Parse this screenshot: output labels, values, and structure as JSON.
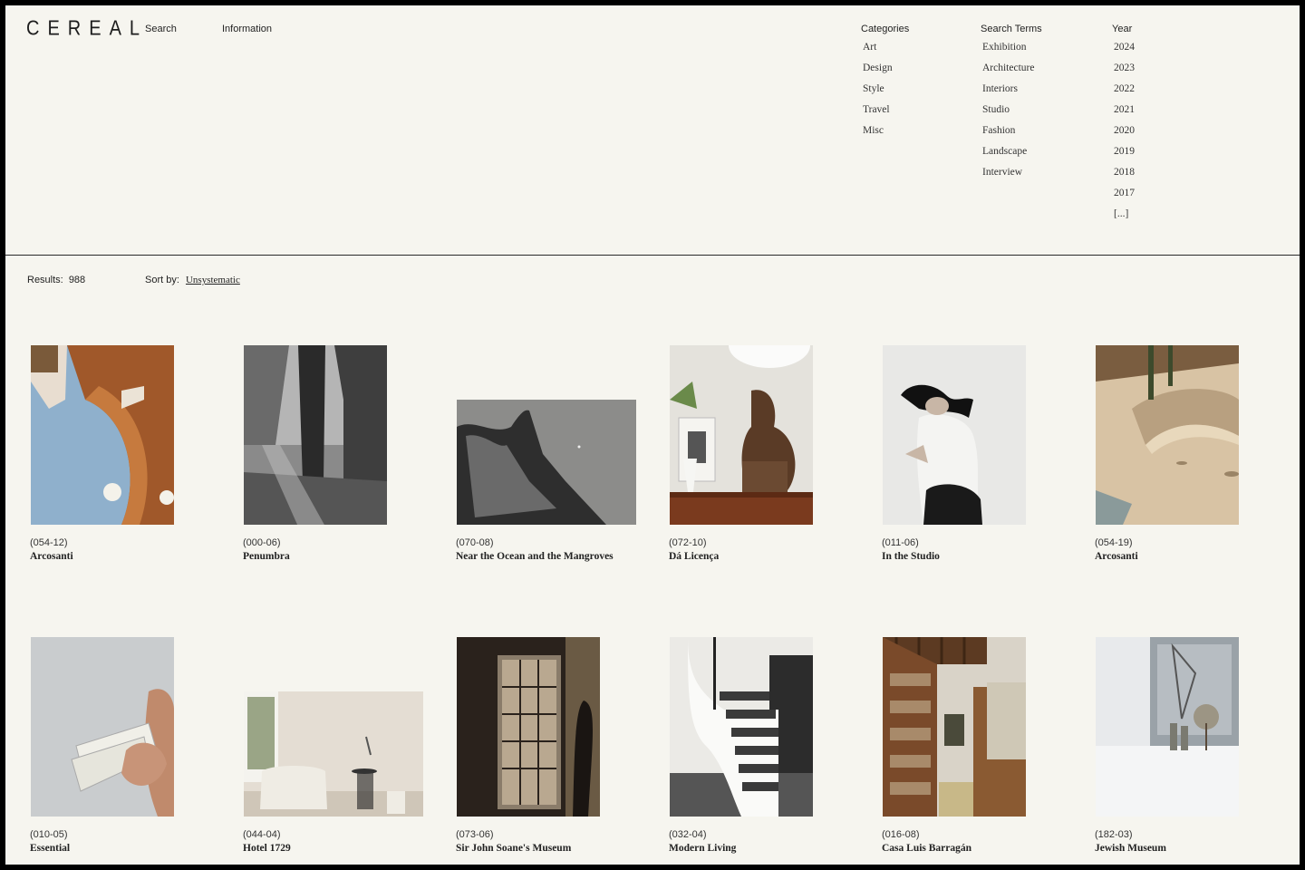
{
  "header": {
    "logo": "CEREAL",
    "nav": {
      "search": "Search",
      "information": "Information"
    }
  },
  "filters": {
    "categories": {
      "heading": "Categories",
      "items": [
        "Art",
        "Design",
        "Style",
        "Travel",
        "Misc"
      ]
    },
    "search_terms": {
      "heading": "Search Terms",
      "items": [
        "Exhibition",
        "Architecture",
        "Interiors",
        "Studio",
        "Fashion",
        "Landscape",
        "Interview"
      ]
    },
    "year": {
      "heading": "Year",
      "items": [
        "2024",
        "2023",
        "2022",
        "2021",
        "2020",
        "2019",
        "2018",
        "2017",
        "[...]"
      ]
    }
  },
  "toolbar": {
    "results_label": "Results:",
    "results_count": "988",
    "sort_label": "Sort by:",
    "sort_value": "Unsystematic"
  },
  "articles": [
    {
      "code": "(054-12)",
      "title": "Arcosanti"
    },
    {
      "code": "(000-06)",
      "title": "Penumbra"
    },
    {
      "code": "(070-08)",
      "title": "Near the Ocean and the Mangroves"
    },
    {
      "code": "(072-10)",
      "title": "Dá Licença"
    },
    {
      "code": "(011-06)",
      "title": "In the Studio"
    },
    {
      "code": "(054-19)",
      "title": "Arcosanti"
    },
    {
      "code": "(010-05)",
      "title": "Essential"
    },
    {
      "code": "(044-04)",
      "title": "Hotel 1729"
    },
    {
      "code": "(073-06)",
      "title": "Sir John Soane's Museum"
    },
    {
      "code": "(032-04)",
      "title": "Modern Living"
    },
    {
      "code": "(016-08)",
      "title": "Casa Luis Barragán"
    },
    {
      "code": "(182-03)",
      "title": "Jewish Museum"
    }
  ]
}
